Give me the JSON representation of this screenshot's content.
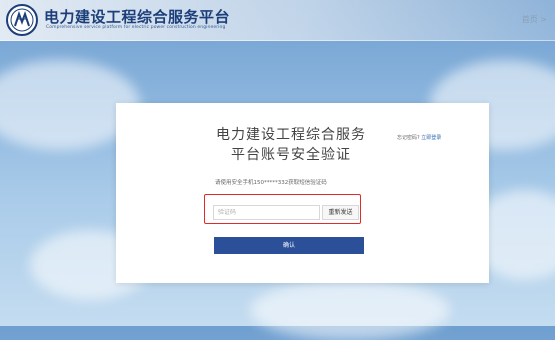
{
  "header": {
    "brand_title": "电力建设工程综合服务平台",
    "brand_subtitle": "Comprehensive service platform for electric power construction engineering",
    "home_link": "首页 >"
  },
  "card": {
    "title_line1": "电力建设工程综合服务",
    "title_line2": "平台账号安全验证",
    "forgot_password": "忘记密码?",
    "login_now": "立即登录",
    "hint": "请使用安全手机150*****332获取短信验证码",
    "code_placeholder": "验证码",
    "resend_label": "重新发送",
    "confirm_label": "确认"
  },
  "colors": {
    "brand": "#1c3f7a",
    "primary_button": "#2c4f9a",
    "highlight_border": "#e02b2b",
    "link": "#2f67b2"
  }
}
